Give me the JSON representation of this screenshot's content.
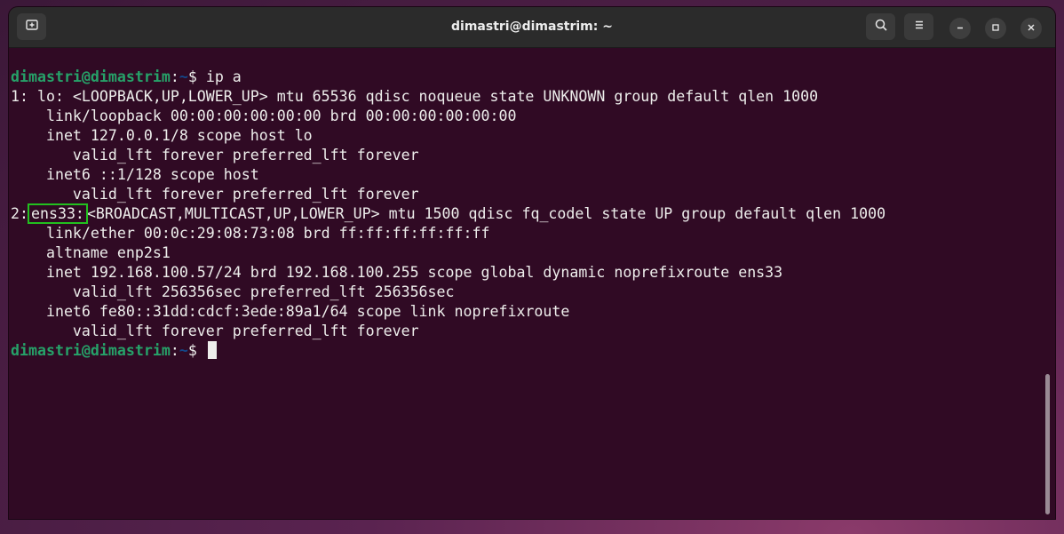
{
  "window": {
    "title": "dimastri@dimastrim: ~"
  },
  "icons": {
    "new_tab": "new-tab-icon",
    "search": "search-icon",
    "menu": "hamburger-menu-icon",
    "minimize": "minimize-icon",
    "maximize": "maximize-icon",
    "close": "close-icon"
  },
  "colors": {
    "terminal_bg": "#300a24",
    "prompt_user": "#26a269",
    "prompt_path": "#12488b",
    "highlight_box": "#22c01f",
    "text": "#eeeeec"
  },
  "terminal": {
    "prompt_user": "dimastri@dimastrim",
    "prompt_sep": ":",
    "prompt_path": "~",
    "prompt_symbol": "$",
    "command": "ip a",
    "lines": [
      "1: lo: <LOOPBACK,UP,LOWER_UP> mtu 65536 qdisc noqueue state UNKNOWN group default qlen 1000",
      "    link/loopback 00:00:00:00:00:00 brd 00:00:00:00:00:00",
      "    inet 127.0.0.1/8 scope host lo",
      "       valid_lft forever preferred_lft forever",
      "    inet6 ::1/128 scope host",
      "       valid_lft forever preferred_lft forever"
    ],
    "iface2_prefix": "2:",
    "iface2_name": "ens33:",
    "iface2_rest": "<BROADCAST,MULTICAST,UP,LOWER_UP> mtu 1500 qdisc fq_codel state UP group default qlen 1000",
    "lines2": [
      "    link/ether 00:0c:29:08:73:08 brd ff:ff:ff:ff:ff:ff",
      "    altname enp2s1",
      "    inet 192.168.100.57/24 brd 192.168.100.255 scope global dynamic noprefixroute ens33",
      "       valid_lft 256356sec preferred_lft 256356sec",
      "    inet6 fe80::31dd:cdcf:3ede:89a1/64 scope link noprefixroute",
      "       valid_lft forever preferred_lft forever"
    ]
  }
}
